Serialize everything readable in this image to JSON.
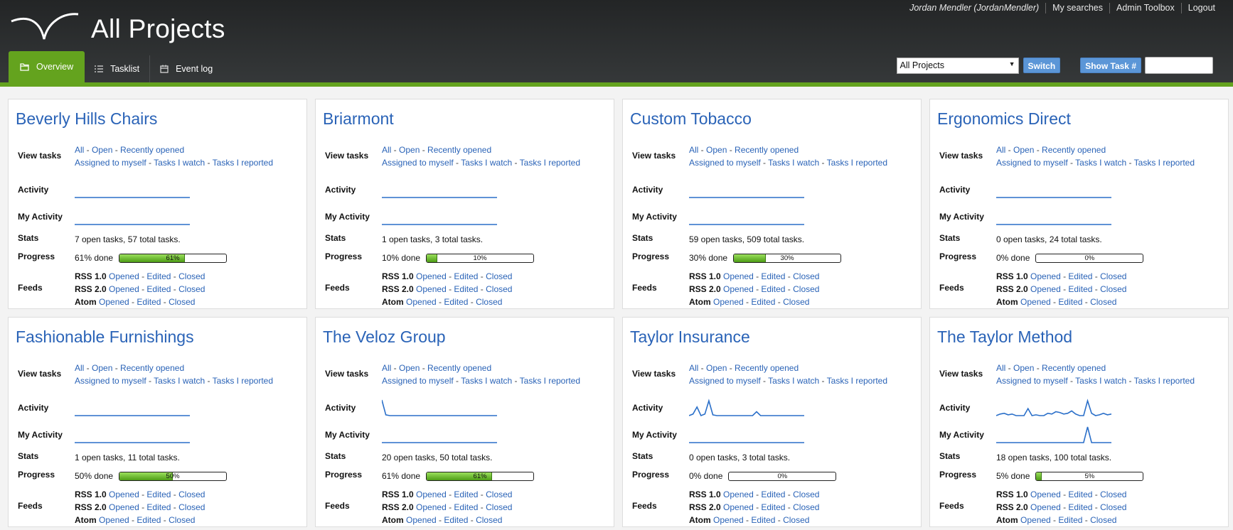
{
  "header": {
    "title": "All Projects",
    "user": "Jordan Mendler (JordanMendler)",
    "links": [
      "My searches",
      "Admin Toolbox",
      "Logout"
    ],
    "tabs": [
      "Overview",
      "Tasklist",
      "Event log"
    ],
    "project_select": "All Projects",
    "switch_label": "Switch",
    "show_task_label": "Show Task #",
    "task_input_value": ""
  },
  "labels": {
    "view_tasks": "View tasks",
    "activity": "Activity",
    "my_activity": "My Activity",
    "stats": "Stats",
    "progress": "Progress",
    "feeds": "Feeds"
  },
  "view_links": {
    "all": "All",
    "open": "Open",
    "recently_opened": "Recently opened",
    "assigned": "Assigned to myself",
    "watch": "Tasks I watch",
    "reported": "Tasks I reported"
  },
  "feeds": {
    "types": [
      "RSS 1.0",
      "RSS 2.0",
      "Atom"
    ],
    "opened": "Opened",
    "edited": "Edited",
    "closed": "Closed"
  },
  "projects": [
    {
      "name": "Beverly Hills Chairs",
      "stats": "7 open tasks, 57 total tasks.",
      "progress_text": "61% done",
      "progress": 61,
      "bar_label": "61%",
      "activity": [
        0,
        0,
        0,
        0,
        0,
        0,
        0,
        0,
        0,
        0,
        0,
        0,
        0,
        0,
        0,
        0,
        0,
        0,
        0,
        0,
        0,
        0,
        0,
        0,
        0,
        0,
        0,
        0,
        0,
        0
      ],
      "my_activity": [
        0,
        0,
        0,
        0,
        0,
        0,
        0,
        0,
        0,
        0,
        0,
        0,
        0,
        0,
        0,
        0,
        0,
        0,
        0,
        0,
        0,
        0,
        0,
        0,
        0,
        0,
        0,
        0,
        0,
        0
      ]
    },
    {
      "name": "Briarmont",
      "stats": "1 open tasks, 3 total tasks.",
      "progress_text": "10% done",
      "progress": 10,
      "bar_label": "10%",
      "activity": [
        0,
        0,
        0,
        0,
        0,
        0,
        0,
        0,
        0,
        0,
        0,
        0,
        0,
        0,
        0,
        0,
        0,
        0,
        0,
        0,
        0,
        0,
        0,
        0,
        0,
        0,
        0,
        0,
        0,
        0
      ],
      "my_activity": [
        0,
        0,
        0,
        0,
        0,
        0,
        0,
        0,
        0,
        0,
        0,
        0,
        0,
        0,
        0,
        0,
        0,
        0,
        0,
        0,
        0,
        0,
        0,
        0,
        0,
        0,
        0,
        0,
        0,
        0
      ]
    },
    {
      "name": "Custom Tobacco",
      "stats": "59 open tasks, 509 total tasks.",
      "progress_text": "30% done",
      "progress": 30,
      "bar_label": "30%",
      "activity": [
        0,
        0,
        0,
        0,
        0,
        0,
        0,
        0,
        0,
        0,
        0,
        0,
        0,
        0,
        0,
        0,
        0,
        0,
        0,
        0,
        0,
        0,
        0,
        0,
        0,
        0,
        0,
        0,
        0,
        0
      ],
      "my_activity": [
        0,
        0,
        0,
        0,
        0,
        0,
        0,
        0,
        0,
        0,
        0,
        0,
        0,
        0,
        0,
        0,
        0,
        0,
        0,
        0,
        0,
        0,
        0,
        0,
        0,
        0,
        0,
        0,
        0,
        0
      ]
    },
    {
      "name": "Ergonomics Direct",
      "stats": "0 open tasks, 24 total tasks.",
      "progress_text": "0% done",
      "progress": 0,
      "bar_label": "0%",
      "activity": [
        0,
        0,
        0,
        0,
        0,
        0,
        0,
        0,
        0,
        0,
        0,
        0,
        0,
        0,
        0,
        0,
        0,
        0,
        0,
        0,
        0,
        0,
        0,
        0,
        0,
        0,
        0,
        0,
        0,
        0
      ],
      "my_activity": [
        0,
        0,
        0,
        0,
        0,
        0,
        0,
        0,
        0,
        0,
        0,
        0,
        0,
        0,
        0,
        0,
        0,
        0,
        0,
        0,
        0,
        0,
        0,
        0,
        0,
        0,
        0,
        0,
        0,
        0
      ]
    },
    {
      "name": "Fashionable Furnishings",
      "stats": "1 open tasks, 11 total tasks.",
      "progress_text": "50% done",
      "progress": 50,
      "bar_label": "50%",
      "activity": [
        0,
        0,
        0,
        0,
        0,
        0,
        0,
        0,
        0,
        0,
        0,
        0,
        0,
        0,
        0,
        0,
        0,
        0,
        0,
        0,
        0,
        0,
        0,
        0,
        0,
        0,
        0,
        0,
        0,
        0
      ],
      "my_activity": [
        0,
        0,
        0,
        0,
        0,
        0,
        0,
        0,
        0,
        0,
        0,
        0,
        0,
        0,
        0,
        0,
        0,
        0,
        0,
        0,
        0,
        0,
        0,
        0,
        0,
        0,
        0,
        0,
        0,
        0
      ]
    },
    {
      "name": "The Veloz Group",
      "stats": "20 open tasks, 50 total tasks.",
      "progress_text": "61% done",
      "progress": 61,
      "bar_label": "61%",
      "activity": [
        1,
        0.05,
        0,
        0,
        0,
        0,
        0,
        0,
        0,
        0,
        0,
        0,
        0,
        0,
        0,
        0,
        0,
        0,
        0,
        0,
        0,
        0,
        0,
        0,
        0,
        0,
        0,
        0,
        0,
        0
      ],
      "my_activity": [
        0,
        0,
        0,
        0,
        0,
        0,
        0,
        0,
        0,
        0,
        0,
        0,
        0,
        0,
        0,
        0,
        0,
        0,
        0,
        0,
        0,
        0,
        0,
        0,
        0,
        0,
        0,
        0,
        0,
        0
      ]
    },
    {
      "name": "Taylor Insurance",
      "stats": "0 open tasks, 3 total tasks.",
      "progress_text": "0% done",
      "progress": 0,
      "bar_label": "0%",
      "activity": [
        0,
        0.1,
        0.55,
        0,
        0.1,
        0.95,
        0.05,
        0,
        0,
        0,
        0,
        0,
        0,
        0,
        0,
        0,
        0,
        0.25,
        0,
        0,
        0,
        0,
        0,
        0,
        0,
        0,
        0,
        0,
        0,
        0
      ],
      "my_activity": [
        0,
        0,
        0,
        0,
        0,
        0,
        0,
        0,
        0,
        0,
        0,
        0,
        0,
        0,
        0,
        0,
        0,
        0,
        0,
        0,
        0,
        0,
        0,
        0,
        0,
        0,
        0,
        0,
        0,
        0
      ]
    },
    {
      "name": "The Taylor Method",
      "stats": "18 open tasks, 100 total tasks.",
      "progress_text": "5% done",
      "progress": 5,
      "bar_label": "5%",
      "activity": [
        0,
        0.1,
        0.15,
        0.05,
        0.1,
        0,
        0,
        0,
        0.45,
        0,
        0.05,
        0,
        0,
        0.15,
        0.1,
        0.25,
        0.2,
        0.1,
        0.15,
        0.3,
        0.1,
        0,
        0,
        0.95,
        0.15,
        0,
        0.05,
        0.15,
        0.05,
        0.1
      ],
      "my_activity": [
        0,
        0,
        0,
        0,
        0,
        0,
        0,
        0,
        0,
        0,
        0,
        0,
        0,
        0,
        0,
        0,
        0,
        0,
        0,
        0,
        0,
        0,
        0,
        1,
        0,
        0,
        0,
        0,
        0,
        0
      ]
    }
  ]
}
